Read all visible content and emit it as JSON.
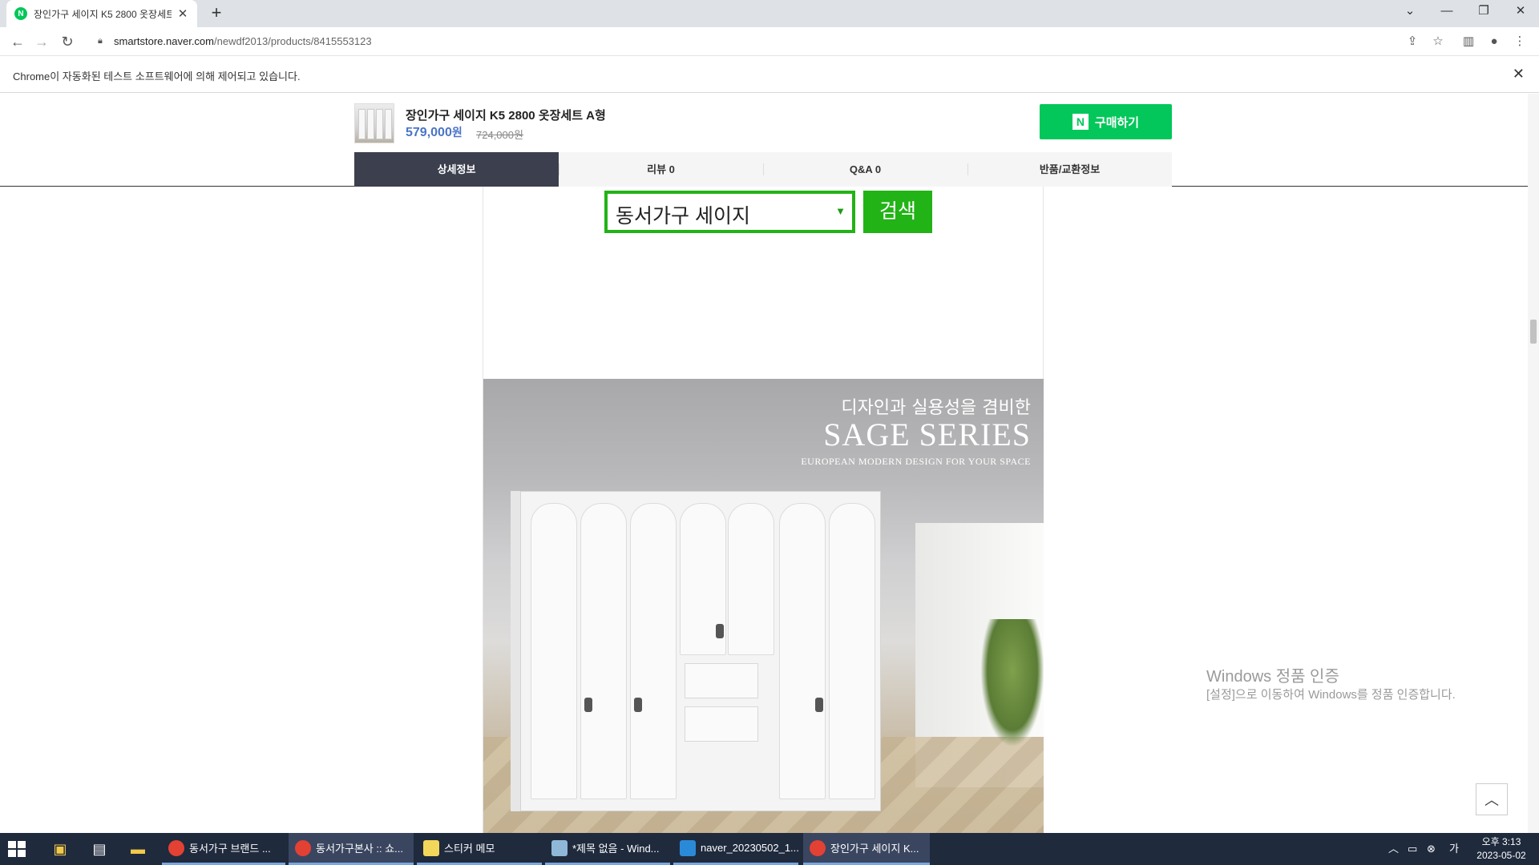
{
  "browser": {
    "tab_title": "장인가구 세이지 K5 2800 옷장세트 A형",
    "tab_favicon_text": "N",
    "url_host": "smartstore.naver.com",
    "url_path": "/newdf2013/products/8415553123",
    "infobar_text": "Chrome이 자동화된 테스트 소프트웨어에 의해 제어되고 있습니다."
  },
  "product": {
    "name": "장인가구 세이지 K5 2800 옷장세트 A형",
    "price": "579,000",
    "price_unit": "원",
    "original_price": "724,000원",
    "buy_label": "구매하기",
    "npay_icon": "N"
  },
  "product_tabs": [
    {
      "label": "상세정보"
    },
    {
      "label": "리뷰 0"
    },
    {
      "label": "Q&A 0"
    },
    {
      "label": "반품/교환정보"
    }
  ],
  "search": {
    "value": "동서가구 세이지",
    "button": "검색"
  },
  "hero": {
    "subtitle": "디자인과 실용성을 겸비한",
    "title": "SAGE SERIES",
    "tagline": "EUROPEAN MODERN DESIGN FOR YOUR SPACE"
  },
  "watermark": {
    "line1": "Windows 정품 인증",
    "line2": "[설정]으로 이동하여 Windows를 정품 인증합니다."
  },
  "taskbar": {
    "tasks": [
      {
        "label": "동서가구 브랜드 ..."
      },
      {
        "label": "동서가구본사 :: 쇼..."
      },
      {
        "label": "스티커 메모"
      },
      {
        "label": "*제목 없음 - Wind..."
      },
      {
        "label": "naver_20230502_1..."
      },
      {
        "label": "장인가구 세이지 K..."
      }
    ],
    "time": "오후 3:13",
    "date": "2023-05-02"
  },
  "colors": {
    "naver_green": "#03c75a",
    "search_green": "#22b316",
    "active_tab": "#3c3f4d",
    "price_blue": "#4a74c7"
  }
}
